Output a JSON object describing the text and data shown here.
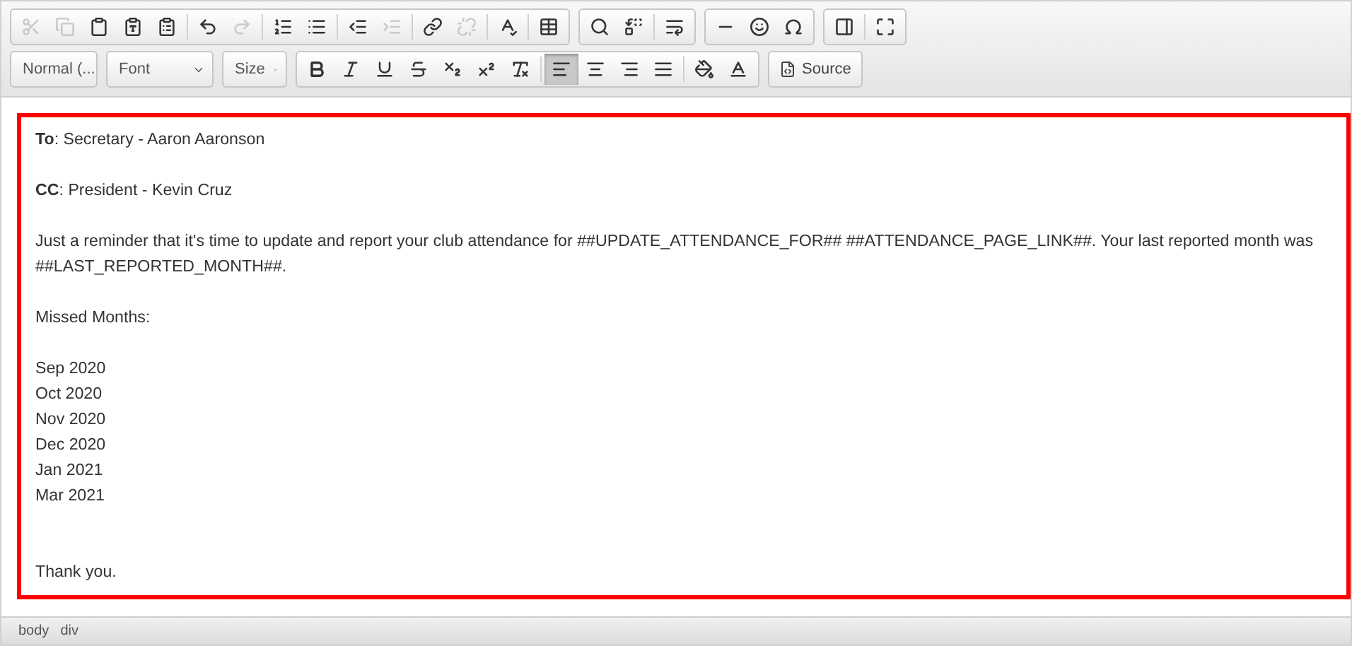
{
  "toolbar_rows": [
    [
      {
        "buttons": [
          {
            "kind": "cut",
            "disabled": true
          },
          {
            "kind": "copy",
            "disabled": true
          },
          {
            "kind": "paste",
            "disabled": false
          },
          {
            "kind": "paste-text",
            "disabled": false
          },
          {
            "kind": "paste-word",
            "disabled": false
          },
          {
            "kind": "sep"
          },
          {
            "kind": "undo",
            "disabled": false
          },
          {
            "kind": "redo",
            "disabled": true
          },
          {
            "kind": "sep"
          },
          {
            "kind": "ordered-list",
            "disabled": false
          },
          {
            "kind": "bullet-list",
            "disabled": false
          },
          {
            "kind": "sep"
          },
          {
            "kind": "outdent",
            "disabled": false
          },
          {
            "kind": "indent",
            "disabled": true
          },
          {
            "kind": "sep"
          },
          {
            "kind": "link",
            "disabled": false
          },
          {
            "kind": "unlink",
            "disabled": true
          },
          {
            "kind": "sep"
          },
          {
            "kind": "spellcheck",
            "disabled": false
          },
          {
            "kind": "sep"
          },
          {
            "kind": "table",
            "disabled": false
          }
        ]
      },
      {
        "buttons": [
          {
            "kind": "find",
            "disabled": false
          },
          {
            "kind": "replace",
            "disabled": false
          },
          {
            "kind": "sep"
          },
          {
            "kind": "block",
            "disabled": false
          }
        ]
      },
      {
        "buttons": [
          {
            "kind": "rule",
            "disabled": false
          },
          {
            "kind": "smiley",
            "disabled": false
          },
          {
            "kind": "omega",
            "disabled": false
          }
        ]
      },
      {
        "buttons": [
          {
            "kind": "show-blocks",
            "disabled": false
          },
          {
            "kind": "sep"
          },
          {
            "kind": "maximize",
            "disabled": false
          }
        ]
      }
    ],
    [
      {
        "combos": [
          "Normal (...",
          "Font",
          "Size"
        ]
      },
      {
        "buttons": [
          {
            "kind": "bold",
            "disabled": false
          },
          {
            "kind": "italic",
            "disabled": false
          },
          {
            "kind": "underline",
            "disabled": false
          },
          {
            "kind": "strike",
            "disabled": false
          },
          {
            "kind": "subscript",
            "disabled": false
          },
          {
            "kind": "superscript",
            "disabled": false
          },
          {
            "kind": "clear-format",
            "disabled": false
          },
          {
            "kind": "sep"
          },
          {
            "kind": "align-left",
            "disabled": false,
            "selected": true
          },
          {
            "kind": "align-center",
            "disabled": false,
            "selected": false
          },
          {
            "kind": "align-right",
            "disabled": false,
            "selected": false
          },
          {
            "kind": "justify",
            "disabled": false,
            "selected": false
          },
          {
            "kind": "sep"
          },
          {
            "kind": "bg-color",
            "disabled": false
          },
          {
            "kind": "text-color",
            "disabled": false
          }
        ]
      },
      {
        "source": "Source"
      }
    ]
  ],
  "content": {
    "to": "**To**: Secretary - Aaron Aaronson",
    "cc": "**CC**: President - Kevin Cruz",
    "message": "Just a reminder that it's time to update and report your club attendance for ##UPDATE_ATTENDANCE_FOR## ##ATTENDANCE_PAGE_LINK##. Your last reported month was ##LAST_REPORTED_MONTH##.",
    "missed_label": "Missed Months:",
    "months": [
      "Sep 2020",
      "Oct 2020",
      "Nov 2020",
      "Dec 2020",
      "Jan 2021",
      "Mar 2021"
    ],
    "closing": "Thank you."
  },
  "status_path": [
    "body",
    "div"
  ]
}
